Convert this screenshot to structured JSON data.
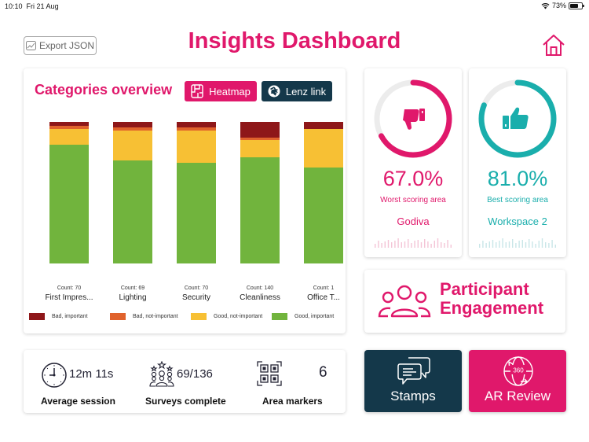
{
  "status_bar": {
    "time": "10:10",
    "date": "Fri 21 Aug",
    "wifi_icon": "wifi-icon",
    "battery_percent": "73%",
    "battery_level": 0.73
  },
  "header": {
    "export_label": "Export JSON",
    "export_icon": "chart-export-icon",
    "title": "Insights Dashboard",
    "home_icon": "home-icon"
  },
  "colors": {
    "brand_pink": "#e0186b",
    "brand_navy": "#14384a",
    "teal": "#1aaeac",
    "bad_important": "#8e1719",
    "bad_not_important": "#e0622c",
    "good_not_important": "#f7c034",
    "good_important": "#71b43d"
  },
  "categories_overview": {
    "title": "Categories overview",
    "heatmap_label": "Heatmap",
    "lenz_label": "Lenz link",
    "legend": [
      {
        "key": "bad_important",
        "label": "Bad, important"
      },
      {
        "key": "bad_not_important",
        "label": "Bad, not-important"
      },
      {
        "key": "good_not_important",
        "label": "Good, not-important"
      },
      {
        "key": "good_important",
        "label": "Good, important"
      }
    ]
  },
  "chart_data": {
    "type": "bar",
    "stacked": true,
    "normalized": true,
    "title": "Categories overview",
    "categories": [
      "First Impres...",
      "Lighting",
      "Security",
      "Cleanliness",
      "Office T..."
    ],
    "counts": [
      "Count: 70",
      "Count: 69",
      "Count: 70",
      "Count: 140",
      "Count: 1"
    ],
    "series": [
      {
        "name": "Bad, important",
        "values": [
          3,
          4,
          4,
          11,
          5
        ]
      },
      {
        "name": "Bad, not-important",
        "values": [
          2,
          2,
          2,
          2,
          0
        ]
      },
      {
        "name": "Good, not-important",
        "values": [
          11,
          21,
          23,
          12,
          27
        ]
      },
      {
        "name": "Good, important",
        "values": [
          84,
          73,
          71,
          75,
          68
        ]
      }
    ],
    "ylim": [
      0,
      100
    ],
    "grid": false,
    "legend_position": "bottom"
  },
  "worst_card": {
    "percent_text": "67.0%",
    "percent_value": 67.0,
    "label": "Worst scoring area",
    "area": "Godiva",
    "icon": "thumbs-down-icon"
  },
  "best_card": {
    "percent_text": "81.0%",
    "percent_value": 81.0,
    "label": "Best scoring area",
    "area": "Workspace 2",
    "icon": "thumbs-up-icon"
  },
  "engagement": {
    "line1": "Participant",
    "line2": "Engagement",
    "icon": "group-icon"
  },
  "stats": {
    "average_session": {
      "value": "12m 11s",
      "label": "Average session",
      "icon": "clock-icon"
    },
    "surveys_complete": {
      "value": "69/136",
      "label": "Surveys complete",
      "icon": "group-stars-icon"
    },
    "area_markers": {
      "value": "6",
      "label": "Area markers",
      "icon": "qr-code-icon"
    }
  },
  "actions": {
    "stamps_label": "Stamps",
    "ar_review_label": "AR Review",
    "ar_badge": "360"
  }
}
